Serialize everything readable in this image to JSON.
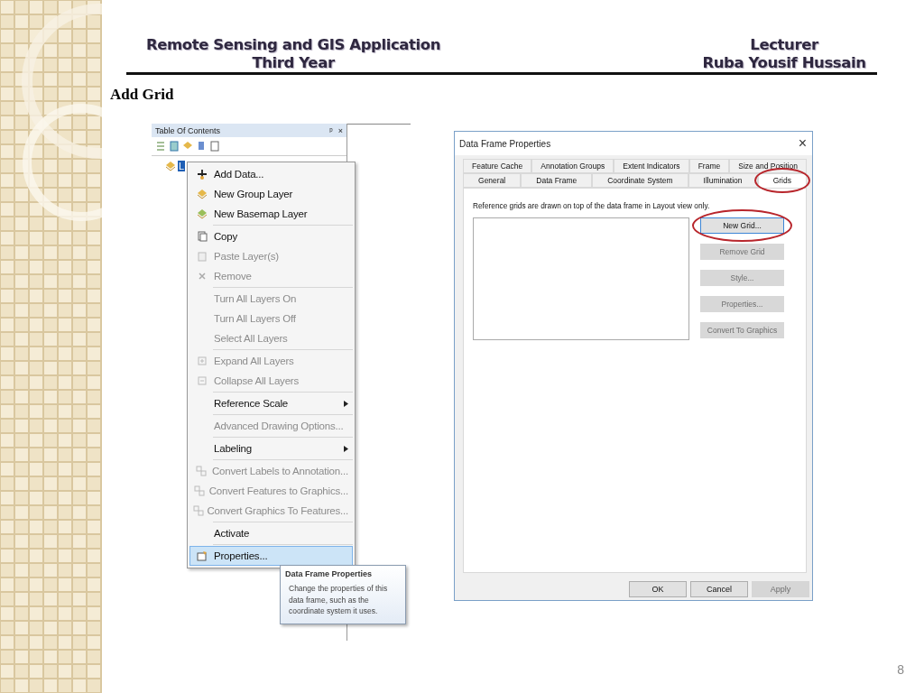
{
  "header": {
    "course": "Remote Sensing and GIS Application",
    "year": "Third Year",
    "role": "Lecturer",
    "lecturer": "Ruba Yousif Hussain"
  },
  "heading": "Add Grid",
  "toc": {
    "title": "Table Of Contents",
    "pin": "ᵖ",
    "close": "×",
    "layer": {
      "label": "L",
      "selected": true
    }
  },
  "context_menu": {
    "groups": [
      [
        {
          "label": "Add Data...",
          "disabled": false,
          "submenu": false,
          "selected": false
        },
        {
          "label": "New Group Layer",
          "disabled": false,
          "submenu": false,
          "selected": false
        },
        {
          "label": "New Basemap Layer",
          "disabled": false,
          "submenu": false,
          "selected": false
        }
      ],
      [
        {
          "label": "Copy",
          "disabled": false,
          "submenu": false,
          "selected": false
        },
        {
          "label": "Paste Layer(s)",
          "disabled": true,
          "submenu": false,
          "selected": false
        },
        {
          "label": "Remove",
          "disabled": true,
          "submenu": false,
          "selected": false
        }
      ],
      [
        {
          "label": "Turn All Layers On",
          "disabled": true,
          "submenu": false,
          "selected": false
        },
        {
          "label": "Turn All Layers Off",
          "disabled": true,
          "submenu": false,
          "selected": false
        },
        {
          "label": "Select All Layers",
          "disabled": true,
          "submenu": false,
          "selected": false
        }
      ],
      [
        {
          "label": "Expand All Layers",
          "disabled": true,
          "submenu": false,
          "selected": false
        },
        {
          "label": "Collapse All Layers",
          "disabled": true,
          "submenu": false,
          "selected": false
        }
      ],
      [
        {
          "label": "Reference Scale",
          "disabled": false,
          "submenu": true,
          "selected": false
        }
      ],
      [
        {
          "label": "Advanced Drawing Options...",
          "disabled": true,
          "submenu": false,
          "selected": false
        }
      ],
      [
        {
          "label": "Labeling",
          "disabled": false,
          "submenu": true,
          "selected": false
        }
      ],
      [
        {
          "label": "Convert Labels to Annotation...",
          "disabled": true,
          "submenu": false,
          "selected": false
        },
        {
          "label": "Convert Features to Graphics...",
          "disabled": true,
          "submenu": false,
          "selected": false
        },
        {
          "label": "Convert Graphics To Features...",
          "disabled": true,
          "submenu": false,
          "selected": false
        }
      ],
      [
        {
          "label": "Activate",
          "disabled": false,
          "submenu": false,
          "selected": false
        }
      ],
      [
        {
          "label": "Properties...",
          "disabled": false,
          "submenu": false,
          "selected": true
        }
      ]
    ]
  },
  "tooltip": {
    "title": "Data Frame Properties",
    "text": "Change the properties of this data frame, such as the coordinate system it uses."
  },
  "dialog": {
    "title": "Data Frame Properties",
    "close": "×",
    "tab_rows": [
      [
        {
          "label": "Feature Cache",
          "selected": false,
          "circled": false
        },
        {
          "label": "Annotation Groups",
          "selected": false,
          "circled": false
        },
        {
          "label": "Extent Indicators",
          "selected": false,
          "circled": false
        },
        {
          "label": "Frame",
          "selected": false,
          "circled": false
        },
        {
          "label": "Size and Position",
          "selected": false,
          "circled": false
        }
      ],
      [
        {
          "label": "General",
          "selected": false,
          "circled": false
        },
        {
          "label": "Data Frame",
          "selected": false,
          "circled": false
        },
        {
          "label": "Coordinate System",
          "selected": false,
          "circled": false
        },
        {
          "label": "Illumination",
          "selected": false,
          "circled": false
        },
        {
          "label": "Grids",
          "selected": true,
          "circled": true
        }
      ]
    ],
    "description": "Reference grids are drawn on top of the data frame in Layout view only.",
    "grid_buttons": [
      {
        "label": "New Grid...",
        "disabled": false,
        "circled": true
      },
      {
        "label": "Remove Grid",
        "disabled": true,
        "circled": false
      },
      {
        "label": "Style...",
        "disabled": true,
        "circled": false
      },
      {
        "label": "Properties...",
        "disabled": true,
        "circled": false
      },
      {
        "label": "Convert To Graphics",
        "disabled": true,
        "circled": false
      }
    ],
    "buttons": [
      {
        "label": "OK",
        "disabled": false
      },
      {
        "label": "Cancel",
        "disabled": false
      },
      {
        "label": "Apply",
        "disabled": true
      }
    ]
  },
  "page_number": "8"
}
